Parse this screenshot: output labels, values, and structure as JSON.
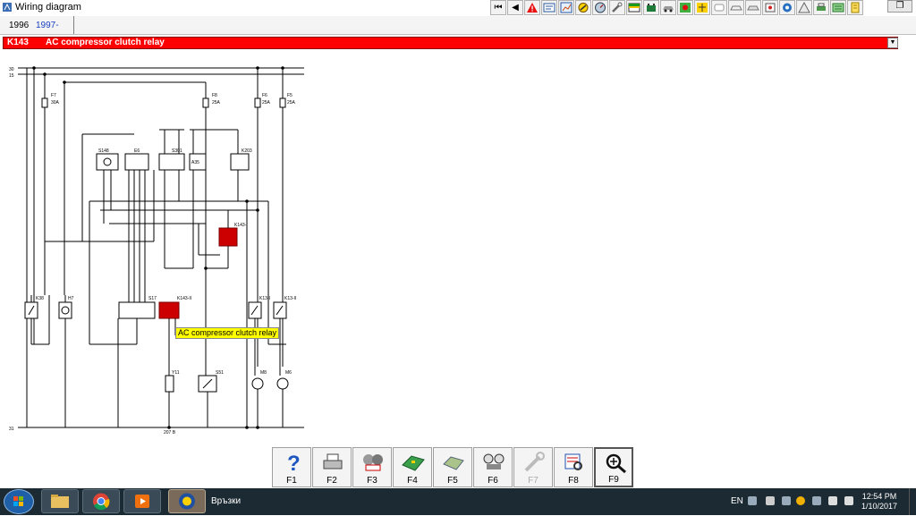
{
  "window": {
    "title": "Wiring diagram",
    "restore_glyph": "❐"
  },
  "toolbar": {
    "icons": [
      "first-icon",
      "prev-icon",
      "warning-icon",
      "sheet-icon",
      "chart-icon",
      "tools-icon",
      "gauge-icon",
      "wrench-icon",
      "table-icon",
      "battery-icon",
      "car-icon",
      "fault-icon",
      "inspect-icon",
      "blank-icon",
      "car-diagram-icon",
      "info-icon",
      "cabin-icon",
      "wheel-icon",
      "service-icon",
      "print-icon",
      "settings-icon",
      "book-icon"
    ]
  },
  "tabs": [
    {
      "label": "1996"
    },
    {
      "label": "1997-"
    }
  ],
  "component": {
    "code": "K143",
    "name": "AC compressor clutch relay",
    "dropdown": "▼"
  },
  "diagram": {
    "rails": {
      "top1": "30",
      "top2": "15",
      "bottom": "31",
      "bottom_ground": "207 B"
    },
    "fuses": [
      {
        "id": "F7",
        "rating": "30A"
      },
      {
        "id": "F8",
        "rating": "25A"
      },
      {
        "id": "F6",
        "rating": "25A"
      },
      {
        "id": "F5",
        "rating": "25A"
      }
    ],
    "components": [
      "S148",
      "E6",
      "S301",
      "A35",
      "K203",
      "K143-I",
      "K38",
      "H7",
      "S17",
      "K143-II",
      "K13-I",
      "K13-II",
      "Y11",
      "S51",
      "M8",
      "M6"
    ],
    "tooltip": "AC compressor clutch relay"
  },
  "fkeys": [
    {
      "label": "F1",
      "icon": "help-icon"
    },
    {
      "label": "F2",
      "icon": "print-icon"
    },
    {
      "label": "F3",
      "icon": "ac-icon"
    },
    {
      "label": "F4",
      "icon": "board-icon"
    },
    {
      "label": "F5",
      "icon": "module-icon"
    },
    {
      "label": "F6",
      "icon": "gauges-icon"
    },
    {
      "label": "F7",
      "icon": "wrench-icon"
    },
    {
      "label": "F8",
      "icon": "search-map-icon"
    },
    {
      "label": "F9",
      "icon": "zoom-icon"
    }
  ],
  "taskbar": {
    "task_label": "Връзки",
    "language": "EN",
    "time": "12:54 PM",
    "date": "1/10/2017"
  }
}
